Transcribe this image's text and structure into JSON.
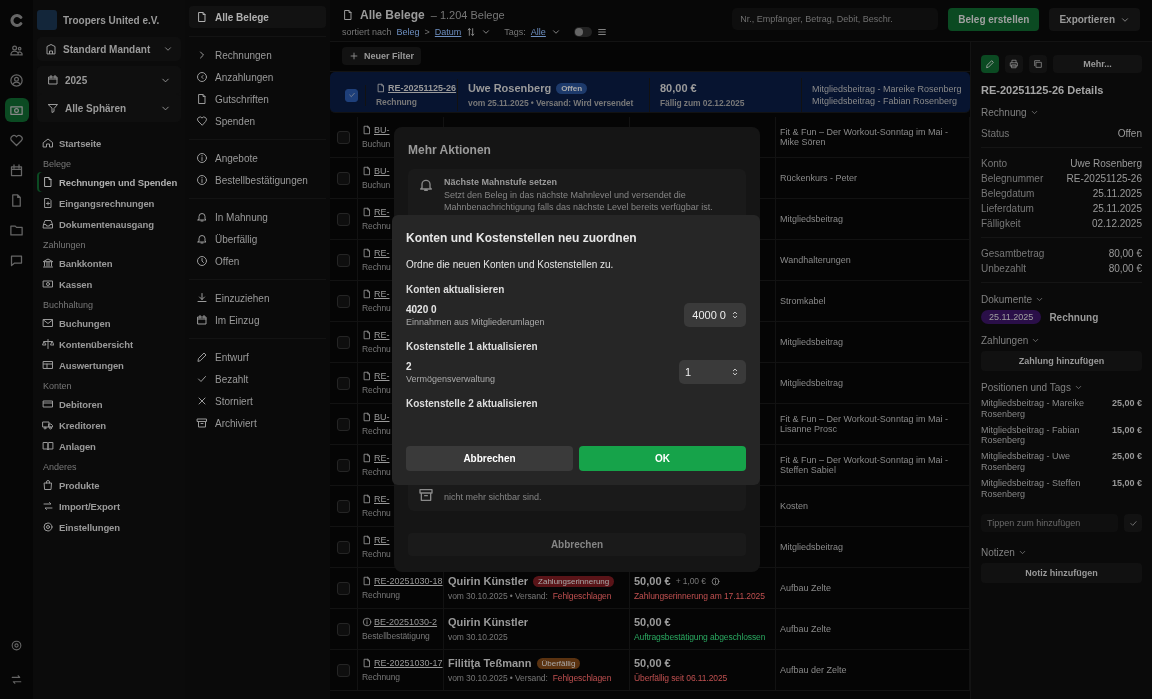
{
  "rail": [
    {
      "selected": false
    },
    {
      "selected": false
    },
    {
      "selected": false
    },
    {
      "selected": true
    },
    {
      "selected": false
    },
    {
      "selected": false
    },
    {
      "selected": false
    },
    {
      "selected": false
    },
    {
      "selected": false
    }
  ],
  "org": {
    "name": "Troopers United e.V.",
    "client": "Standard Mandant",
    "year": "2025",
    "sphere": "Alle Sphären"
  },
  "nav": [
    {
      "items": [
        {
          "label": "Startseite",
          "selected": false
        }
      ]
    },
    {
      "heading": "Belege",
      "items": [
        {
          "label": "Rechnungen und Spenden",
          "selected": true
        },
        {
          "label": "Eingangsrechnungen",
          "selected": false
        },
        {
          "label": "Dokumentenausgang",
          "selected": false
        }
      ]
    },
    {
      "heading": "Zahlungen",
      "items": [
        {
          "label": "Bankkonten",
          "selected": false
        },
        {
          "label": "Kassen",
          "selected": false
        }
      ]
    },
    {
      "heading": "Buchhaltung",
      "items": [
        {
          "label": "Buchungen",
          "selected": false
        },
        {
          "label": "Kontenübersicht",
          "selected": false
        },
        {
          "label": "Auswertungen",
          "selected": false
        }
      ]
    },
    {
      "heading": "Konten",
      "items": [
        {
          "label": "Debitoren",
          "selected": false
        },
        {
          "label": "Kreditoren",
          "selected": false
        },
        {
          "label": "Anlagen",
          "selected": false
        }
      ]
    },
    {
      "heading": "Anderes",
      "items": [
        {
          "label": "Produkte",
          "selected": false
        },
        {
          "label": "Import/Export",
          "selected": false
        },
        {
          "label": "Einstellungen",
          "selected": false
        }
      ]
    }
  ],
  "subnav": {
    "all": {
      "label": "Alle Belege",
      "selected": true
    },
    "groups": [
      [
        {
          "label": "Rechnungen",
          "selected": false
        },
        {
          "label": "Anzahlungen",
          "selected": false
        },
        {
          "label": "Gutschriften",
          "selected": false
        },
        {
          "label": "Spenden",
          "selected": false
        }
      ],
      [
        {
          "label": "Angebote",
          "selected": false
        },
        {
          "label": "Bestellbestätigungen",
          "selected": false
        }
      ],
      [
        {
          "label": "In Mahnung",
          "selected": false
        },
        {
          "label": "Überfällig",
          "selected": false
        },
        {
          "label": "Offen",
          "selected": false
        }
      ],
      [
        {
          "label": "Einzuziehen",
          "selected": false
        },
        {
          "label": "Im Einzug",
          "selected": false
        }
      ],
      [
        {
          "label": "Entwurf",
          "selected": false
        },
        {
          "label": "Bezahlt",
          "selected": false
        },
        {
          "label": "Storniert",
          "selected": false
        },
        {
          "label": "Archiviert",
          "selected": false
        }
      ]
    ]
  },
  "header": {
    "title": "Alle Belege",
    "count": "– 1.204 Belege",
    "sort_label": "sortiert nach",
    "sort_a": "Beleg",
    "sort_sep": ">",
    "sort_b": "Datum",
    "tags_label": "Tags:",
    "tags_value": "Alle",
    "toggle_on": false,
    "search_placeholder": "Nr., Empfänger, Betrag, Debit, Beschr.",
    "create": "Beleg erstellen",
    "export": "Exportieren",
    "new_filter": "Neuer Filter"
  },
  "rows": [
    {
      "kind": "full",
      "selected": true,
      "checked": true,
      "number": "RE-20251125-26",
      "type": "Rechnung",
      "name": "Uwe Rosenberg",
      "badge": {
        "label": "Offen",
        "color": "#1d3a6b"
      },
      "meta": "vom 25.11.2025 • Versand: Wird versendet",
      "shipping": "",
      "amount": "80,00 €",
      "extra": "",
      "status": {
        "text": "Fällig zum 02.12.2025",
        "kind": "muted"
      },
      "desc": [
        "Mitgliedsbeitrag - Mareike Rosenberg",
        "Mitgliedsbeitrag - Fabian Rosenberg"
      ]
    },
    {
      "kind": "covered",
      "selected": false,
      "checked": false,
      "number": "BU-",
      "type": "Buchun",
      "desc": [
        "Fit & Fun – Der Workout-Sonntag im Mai - Mike Sören"
      ]
    },
    {
      "kind": "covered",
      "selected": false,
      "checked": false,
      "number": "BU-",
      "type": "Buchun",
      "desc": [
        "Rückenkurs - Peter"
      ]
    },
    {
      "kind": "covered",
      "selected": false,
      "checked": false,
      "number": "RE-",
      "type": "Rechnu",
      "desc": [
        "Mitgliedsbeitrag"
      ]
    },
    {
      "kind": "covered",
      "selected": false,
      "checked": false,
      "number": "RE-",
      "type": "Rechnu",
      "desc": [
        "Wandhalterungen"
      ]
    },
    {
      "kind": "covered",
      "selected": false,
      "checked": false,
      "number": "RE-",
      "type": "Rechnu",
      "desc": [
        "Stromkabel"
      ]
    },
    {
      "kind": "covered",
      "selected": false,
      "checked": false,
      "number": "RE-",
      "type": "Rechnu",
      "desc": [
        "Mitgliedsbeitrag"
      ]
    },
    {
      "kind": "covered",
      "selected": false,
      "checked": false,
      "number": "RE-",
      "type": "Rechnu",
      "desc": [
        "Mitgliedsbeitrag"
      ]
    },
    {
      "kind": "covered",
      "selected": false,
      "checked": false,
      "number": "BU-",
      "type": "Rechnu",
      "desc": [
        "Fit & Fun – Der Workout-Sonntag im Mai - Lisanne Prosc"
      ]
    },
    {
      "kind": "covered",
      "selected": false,
      "checked": false,
      "number": "RE-",
      "type": "Rechnu",
      "desc": [
        "Fit & Fun – Der Workout-Sonntag im Mai - Steffen Sabiel"
      ]
    },
    {
      "kind": "covered",
      "selected": false,
      "checked": false,
      "number": "RE-",
      "type": "Rechnu",
      "desc": [
        "Kosten"
      ]
    },
    {
      "kind": "covered",
      "selected": false,
      "checked": false,
      "number": "RE-",
      "type": "Rechnu",
      "desc": [
        "Mitgliedsbeitrag"
      ]
    },
    {
      "kind": "full",
      "selected": false,
      "checked": false,
      "number": "RE-20251030-18",
      "type": "Rechnung",
      "name": "Quirin Künstler",
      "badge": {
        "label": "Zahlungserinnerung",
        "color": "#5a1418"
      },
      "meta": "vom 30.10.2025 • Versand:",
      "shipping": "Fehlgeschlagen",
      "amount": "50,00 €",
      "extra": "+ 1,00 €",
      "status": {
        "text": "Zahlungserinnerung am 17.11.2025",
        "kind": "danger"
      },
      "desc": [
        "Aufbau Zelte"
      ]
    },
    {
      "kind": "full",
      "selected": false,
      "checked": false,
      "number": "BE-20251030-2",
      "type": "Bestellbestätigung",
      "name": "Quirin Künstler",
      "meta": "vom 30.10.2025",
      "shipping": "",
      "amount": "50,00 €",
      "extra": "",
      "status": {
        "text": "Auftragsbestätigung abgeschlossen",
        "kind": "success"
      },
      "desc": [
        "Aufbau Zelte"
      ]
    },
    {
      "kind": "full",
      "selected": false,
      "checked": false,
      "number": "RE-20251030-17",
      "type": "Rechnung",
      "name": "Filitiţa Teßmann",
      "badge": {
        "label": "Überfällig",
        "color": "#5a3210"
      },
      "meta": "vom 30.10.2025 • Versand:",
      "shipping": "Fehlgeschlagen",
      "amount": "50,00 €",
      "extra": "",
      "status": {
        "text": "Überfällig seit 06.11.2025",
        "kind": "danger"
      },
      "desc": [
        "Aufbau der Zelte"
      ]
    }
  ],
  "details": {
    "more": "Mehr...",
    "title": "RE-20251125-26 Details",
    "section": "Rechnung",
    "groups": [
      [
        {
          "label": "Status",
          "value": "Offen"
        }
      ],
      [
        {
          "label": "Konto",
          "value": "Uwe Rosenberg"
        },
        {
          "label": "Belegnummer",
          "value": "RE-20251125-26"
        },
        {
          "label": "Belegdatum",
          "value": "25.11.2025"
        },
        {
          "label": "Lieferdatum",
          "value": "25.11.2025"
        },
        {
          "label": "Fälligkeit",
          "value": "02.12.2025"
        }
      ],
      [
        {
          "label": "Gesamtbetrag",
          "value": "80,00 €"
        },
        {
          "label": "Unbezahlt",
          "value": "80,00 €"
        }
      ]
    ],
    "documents_title": "Dokumente",
    "document": {
      "date": "25.11.2025",
      "name": "Rechnung"
    },
    "payments_title": "Zahlungen",
    "add_payment": "Zahlung hinzufügen",
    "positions_title": "Positionen und Tags",
    "positions": [
      {
        "label": "Mitgliedsbeitrag - Mareike Rosenberg",
        "amount": "25,00 €"
      },
      {
        "label": "Mitgliedsbeitrag - Fabian Rosenberg",
        "amount": "15,00 €"
      },
      {
        "label": "Mitgliedsbeitrag - Uwe Rosenberg",
        "amount": "25,00 €"
      },
      {
        "label": "Mitgliedsbeitrag - Steffen Rosenberg",
        "amount": "15,00 €"
      }
    ],
    "tag_placeholder": "Tippen zum hinzufügen",
    "notes_title": "Notizen",
    "add_note": "Notiz hinzufügen"
  },
  "more_dialog": {
    "title": "Mehr Aktionen",
    "first_action": {
      "title": "Nächste Mahnstufe setzen",
      "description": "Setzt den Beleg in das nächste Mahnlevel und versendet die Mahnbenachrichtigung falls das nächste Level bereits verfügbar ist."
    },
    "last_action_tail": "nicht mehr sichtbar sind.",
    "cancel": "Abbrechen"
  },
  "reassign_dialog": {
    "title": "Konten und Kostenstellen neu zuordnen",
    "intro": "Ordne die neuen Konten und Kostenstellen zu.",
    "sections": [
      {
        "title": "Konten aktualisieren",
        "code": "4020 0",
        "name": "Einnahmen aus Mitgliederumlagen",
        "value": "4000 0",
        "kind": "right"
      },
      {
        "title": "Kostenstelle 1 aktualisieren",
        "code": "2",
        "name": "Vermögensverwaltung",
        "value": "1",
        "kind": "left"
      },
      {
        "title": "Kostenstelle 2 aktualisieren"
      }
    ],
    "cancel": "Abbrechen",
    "ok": "OK"
  }
}
